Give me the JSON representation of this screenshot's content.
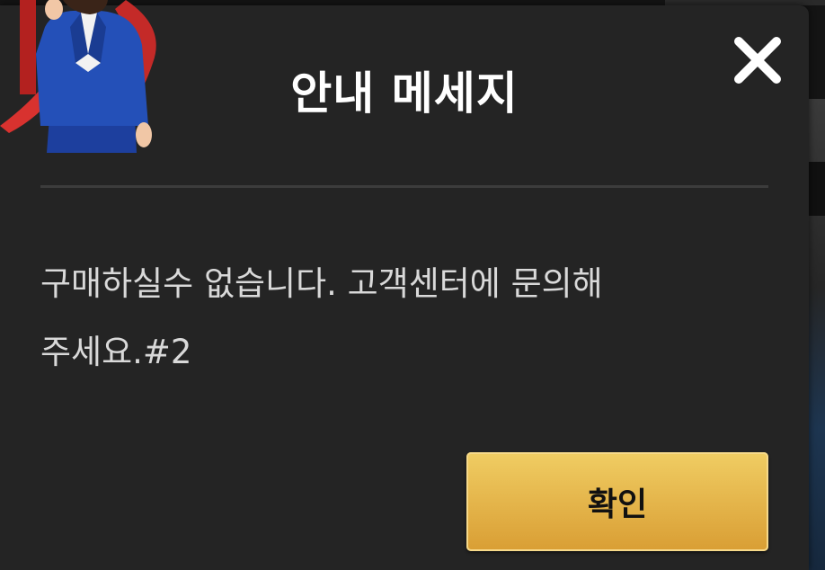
{
  "dialog": {
    "title": "안내 메세지",
    "message_line1": "구매하실수 없습니다. 고객센터에 문의해",
    "message_line2": "주세요.#2",
    "confirm_label": "확인",
    "close_icon": "close-icon",
    "mascot_icon": "mascot-illustration"
  },
  "colors": {
    "dialog_bg": "#242424",
    "button_gold": "#e4b548",
    "title_text": "#ffffff",
    "message_text": "#d9d9d9"
  }
}
